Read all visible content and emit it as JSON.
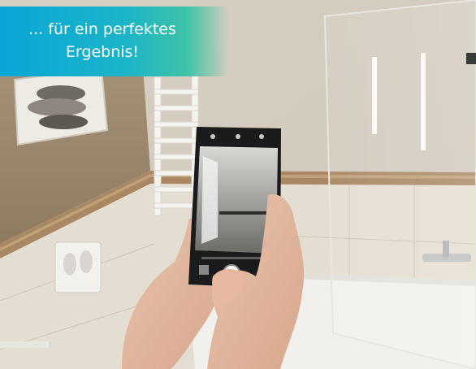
{
  "caption": {
    "text": "... für ein perfektes\nErgebnis!"
  },
  "colors": {
    "caption_gradient_start": "#0aa6d6",
    "caption_gradient_end": "#3fc3a6",
    "caption_text": "#ffffff"
  }
}
